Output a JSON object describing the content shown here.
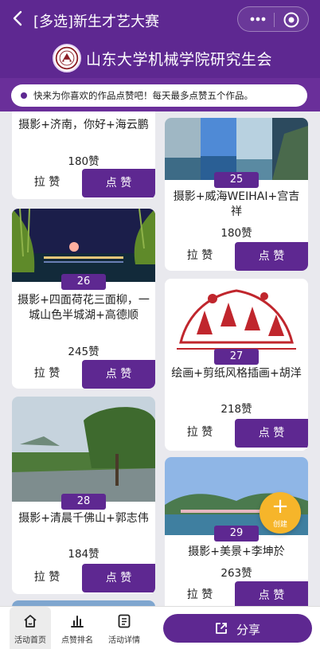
{
  "header": {
    "title": "[多选]新生才艺大赛",
    "org_name": "山东大学机械学院研究生会",
    "notice": "快来为你喜欢的作品点赞吧！每天最多点赞五个作品。"
  },
  "buttons": {
    "pull": "拉 赞",
    "like": "点 赞"
  },
  "cards": {
    "c24": {
      "title": "摄影+济南，你好+海云鹏",
      "votes": "180赞"
    },
    "c25": {
      "number": "25",
      "title": "摄影+威海WEIHAI+宫吉祥",
      "votes": "180赞"
    },
    "c26": {
      "number": "26",
      "title": "摄影+四面荷花三面柳，一城山色半城湖+高德顺",
      "votes": "245赞"
    },
    "c27": {
      "number": "27",
      "title": "绘画+剪纸风格插画+胡洋",
      "votes": "218赞"
    },
    "c28": {
      "number": "28",
      "title": "摄影+清晨千佛山+郭志伟",
      "votes": "184赞"
    },
    "c29": {
      "number": "29",
      "title": "摄影+美景+李坤於",
      "votes": "263赞"
    }
  },
  "fab": {
    "plus": "+",
    "label": "创建"
  },
  "nav": {
    "home": "活动首页",
    "ranking": "点赞排名",
    "details": "活动详情",
    "share": "分享"
  },
  "colors": {
    "brand": "#5e2891",
    "fab": "#f6b52a",
    "feed_bg": "#e9e9ee"
  }
}
